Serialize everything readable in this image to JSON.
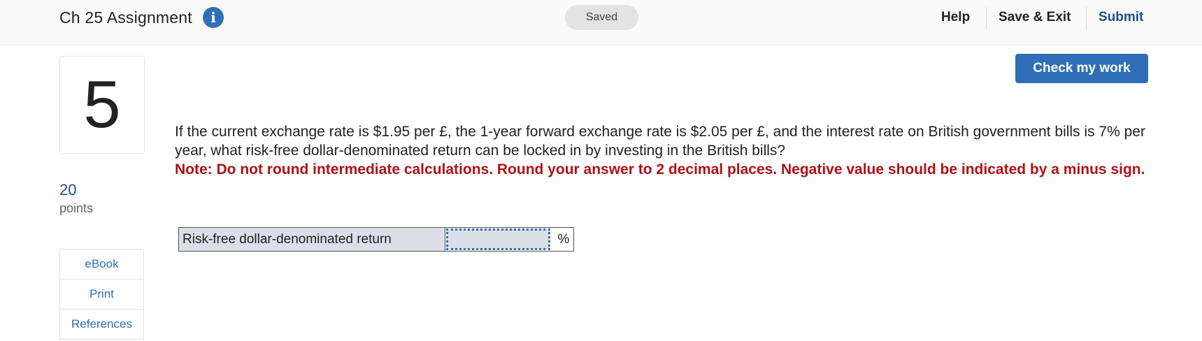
{
  "header": {
    "title": "Ch 25 Assignment",
    "info_icon": "info-icon",
    "status": "Saved",
    "nav": {
      "help": "Help",
      "save_exit": "Save & Exit",
      "submit": "Submit"
    }
  },
  "actions": {
    "check_my_work": "Check my work"
  },
  "sidebar": {
    "question_number": "5",
    "points_value": "20",
    "points_label": "points",
    "tools": [
      {
        "label": "eBook"
      },
      {
        "label": "Print"
      },
      {
        "label": "References"
      }
    ]
  },
  "question": {
    "text": "If the current exchange rate is $1.95 per £, the 1-year forward exchange rate is $2.05 per £, and the interest rate on British government bills is 7% per year, what risk-free dollar-denominated return can be locked in by investing in the British bills?",
    "note": "Note: Do not round intermediate calculations. Round your answer to 2 decimal places. Negative value should be indicated by a minus sign."
  },
  "answer": {
    "label": "Risk-free dollar-denominated return",
    "value": "",
    "unit": "%"
  },
  "colors": {
    "accent": "#2f6fb8",
    "note_red": "#b11116",
    "points_blue": "#1f4e8a"
  }
}
